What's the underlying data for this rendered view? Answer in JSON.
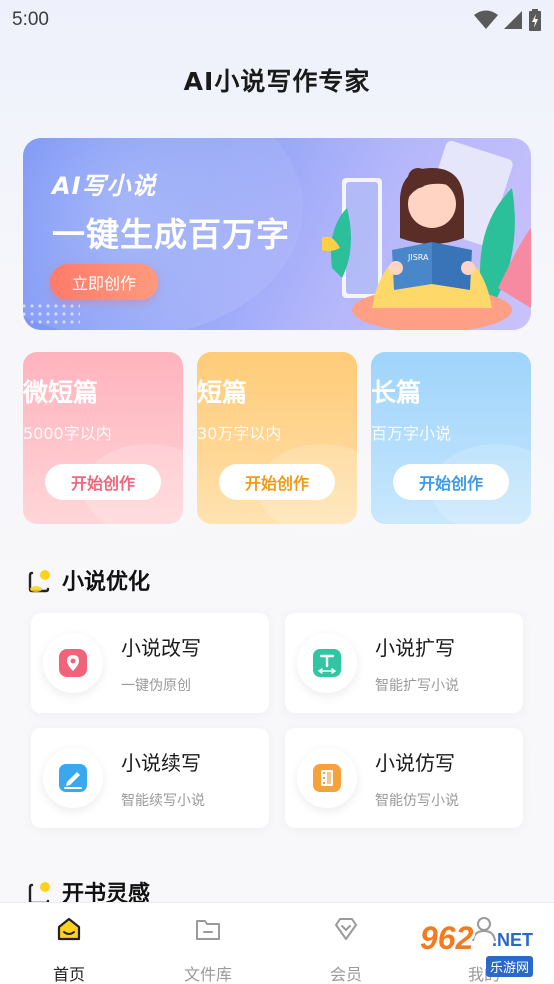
{
  "status_bar": {
    "time": "5:00"
  },
  "app_title": "AI小说写作专家",
  "banner": {
    "subtitle": "AI写小说",
    "headline": "一键生成百万字",
    "button_label": "立即创作",
    "book_text": "JISRA"
  },
  "categories": [
    {
      "title": "微短篇",
      "desc": "5000字以内",
      "button": "开始创作",
      "accent": "#f2657c"
    },
    {
      "title": "短篇",
      "desc": "30万字以内",
      "button": "开始创作",
      "accent": "#f29b12"
    },
    {
      "title": "长篇",
      "desc": "百万字小说",
      "button": "开始创作",
      "accent": "#3a9be8"
    }
  ],
  "section_optimize": {
    "title": "小说优化"
  },
  "tools": [
    {
      "title": "小说改写",
      "desc": "一键伪原创",
      "icon": "location-pin-icon",
      "color": "#f0637a"
    },
    {
      "title": "小说扩写",
      "desc": "智能扩写小说",
      "icon": "text-expand-icon",
      "color": "#2fc6a0"
    },
    {
      "title": "小说续写",
      "desc": "智能续写小说",
      "icon": "pen-icon",
      "color": "#3aa8ee"
    },
    {
      "title": "小说仿写",
      "desc": "智能仿写小说",
      "icon": "film-icon",
      "color": "#f5a23a"
    }
  ],
  "section_inspiration": {
    "title": "开书灵感"
  },
  "bottom_nav": [
    {
      "label": "首页",
      "active": true
    },
    {
      "label": "文件库",
      "active": false
    },
    {
      "label": "会员",
      "active": false
    },
    {
      "label": "我的",
      "active": false
    }
  ],
  "watermark": {
    "number": "962",
    "suffix": ".NET",
    "sub": "乐游网"
  }
}
